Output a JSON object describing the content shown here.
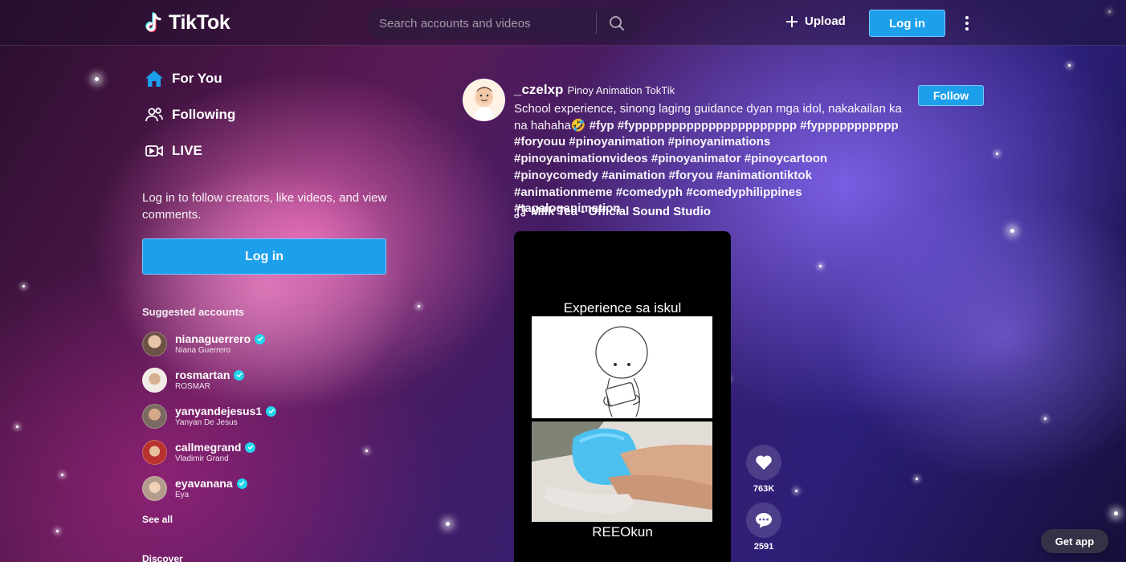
{
  "header": {
    "logo_text": "TikTok",
    "search_placeholder": "Search accounts and videos",
    "upload_label": "Upload",
    "login_label": "Log in"
  },
  "sidebar": {
    "nav": [
      {
        "label": "For You",
        "icon": "home-icon",
        "active": true
      },
      {
        "label": "Following",
        "icon": "people-icon"
      },
      {
        "label": "LIVE",
        "icon": "live-camera-icon"
      }
    ],
    "login_prompt": "Log in to follow creators, like videos, and view comments.",
    "login_button": "Log in",
    "suggested_title": "Suggested accounts",
    "suggested": [
      {
        "username": "nianaguerrero",
        "name": "Niana Guerrero",
        "verified": true,
        "avatar_color": "#c9a58a"
      },
      {
        "username": "rosmartan",
        "name": "ROSMAR",
        "verified": true,
        "avatar_color": "#e8d9cb"
      },
      {
        "username": "yanyandejesus1",
        "name": "Yanyan De Jesus",
        "verified": true,
        "avatar_color": "#a88b79"
      },
      {
        "username": "callmegrand",
        "name": "Vladimir Grand",
        "verified": true,
        "avatar_color": "#b8322e"
      },
      {
        "username": "eyavanana",
        "name": "Eya",
        "verified": true,
        "avatar_color": "#d8b89e"
      }
    ],
    "see_all": "See all",
    "discover": "Discover"
  },
  "post": {
    "username": "_czelxp",
    "nickname": "Pinoy Animation TokTik",
    "follow_label": "Follow",
    "description_text": "School experience, sinong laging guidance dyan mga idol, nakakailan ka na hahaha🤣 ",
    "description_tags": "#fyp #fypppppppppppppppppppppp #fyppppppppppp #foryouu #pinoyanimation #pinoyanimations #pinoyanimationvideos #pinoyanimator #pinoycartoon #pinoycomedy #animation #foryou #animationtiktok #animationmeme #comedyph #comedyphilippines #tagaloganimation",
    "music": "Milk Tea - Official Sound Studio",
    "video_caption_top": "Experience sa iskul",
    "video_caption_bottom": "REEOkun",
    "like_count": "763K",
    "comment_count": "2591"
  },
  "floating": {
    "get_app": "Get app"
  },
  "colors": {
    "accent": "#1da0ec",
    "verified": "#20d5ec",
    "home_active": "#1da0ec"
  }
}
